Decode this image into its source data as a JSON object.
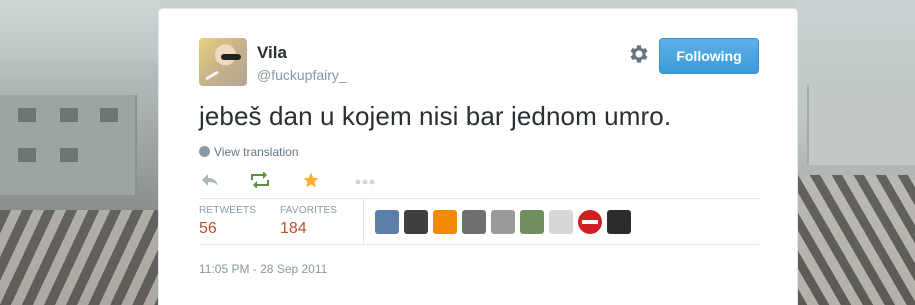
{
  "tweet": {
    "display_name": "Vila",
    "username": "@fuckupfairy_",
    "text": "jebeš dan u kojem nisi bar jednom umro.",
    "translate_label": "View translation",
    "timestamp": "11:05 PM - 28 Sep 2011"
  },
  "header": {
    "follow_label": "Following",
    "gear_icon": "gear-icon"
  },
  "actions": {
    "reply_icon": "reply-icon",
    "retweet_icon": "retweet-icon",
    "favorite_icon": "star-icon",
    "more_icon": "more-icon"
  },
  "stats": {
    "retweets_label": "RETWEETS",
    "retweets_value": "56",
    "favorites_label": "FAVORITES",
    "favorites_value": "184"
  },
  "favoriters": [
    {
      "name": "favoriter-avatar-1",
      "color": "#5b7fa6"
    },
    {
      "name": "favoriter-avatar-2",
      "color": "#3f3f3f"
    },
    {
      "name": "favoriter-avatar-3",
      "color": "#f08a00"
    },
    {
      "name": "favoriter-avatar-4",
      "color": "#707070"
    },
    {
      "name": "favoriter-avatar-5",
      "color": "#9a9a9a"
    },
    {
      "name": "favoriter-avatar-6",
      "color": "#6f8f5f"
    },
    {
      "name": "favoriter-avatar-7",
      "color": "#d8d8d8"
    },
    {
      "name": "favoriter-avatar-8",
      "color": "#d01f1f"
    },
    {
      "name": "favoriter-avatar-9",
      "color": "#2c2c2c"
    }
  ],
  "colors": {
    "accent": "#4aa3df",
    "retweet_green": "#5c913b",
    "favorite_gold": "#ffac33",
    "stat_value": "#bb4f33"
  }
}
